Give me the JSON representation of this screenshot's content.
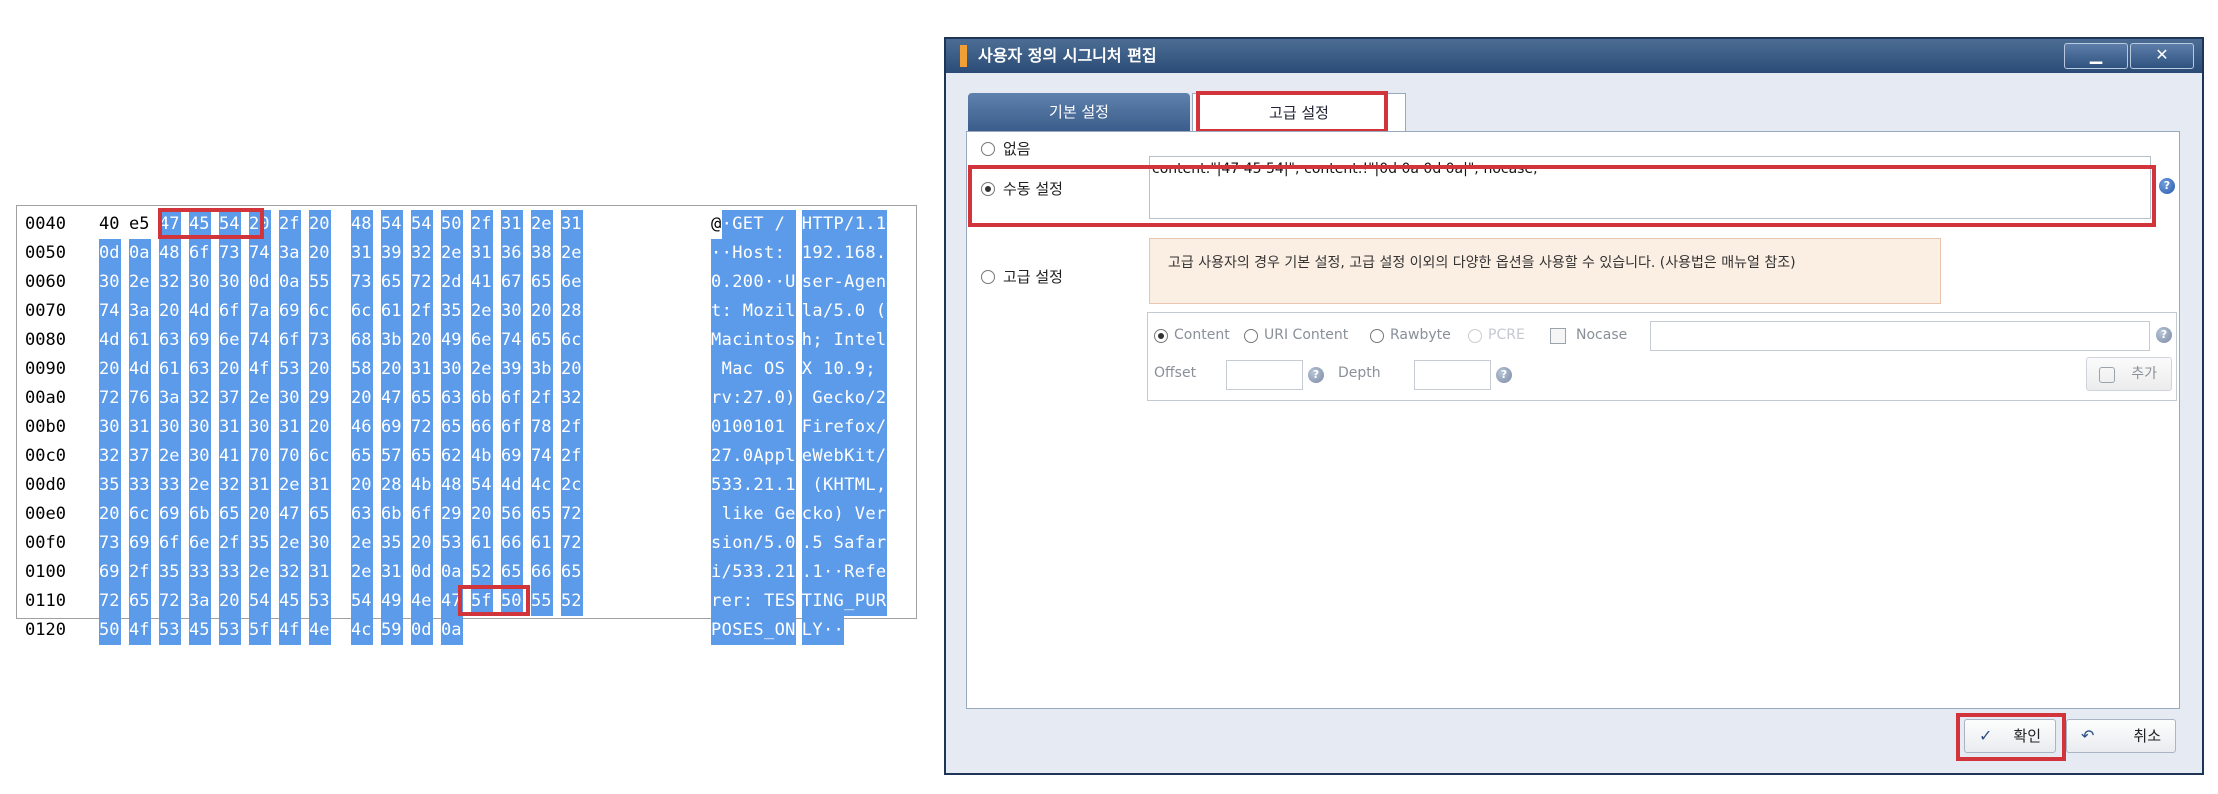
{
  "hexdump": {
    "rows": [
      {
        "offset": "0040",
        "hex": [
          "40",
          "e5",
          "47",
          "45",
          "54",
          "20",
          "2f",
          "20",
          "48",
          "54",
          "54",
          "50",
          "2f",
          "31",
          "2e",
          "31"
        ],
        "ascii": "@·GET / HTTP/1.1"
      },
      {
        "offset": "0050",
        "hex": [
          "0d",
          "0a",
          "48",
          "6f",
          "73",
          "74",
          "3a",
          "20",
          "31",
          "39",
          "32",
          "2e",
          "31",
          "36",
          "38",
          "2e"
        ],
        "ascii": "··Host: 192.168."
      },
      {
        "offset": "0060",
        "hex": [
          "30",
          "2e",
          "32",
          "30",
          "30",
          "0d",
          "0a",
          "55",
          "73",
          "65",
          "72",
          "2d",
          "41",
          "67",
          "65",
          "6e"
        ],
        "ascii": "0.200··User-Agen"
      },
      {
        "offset": "0070",
        "hex": [
          "74",
          "3a",
          "20",
          "4d",
          "6f",
          "7a",
          "69",
          "6c",
          "6c",
          "61",
          "2f",
          "35",
          "2e",
          "30",
          "20",
          "28"
        ],
        "ascii": "t: Mozilla/5.0 ("
      },
      {
        "offset": "0080",
        "hex": [
          "4d",
          "61",
          "63",
          "69",
          "6e",
          "74",
          "6f",
          "73",
          "68",
          "3b",
          "20",
          "49",
          "6e",
          "74",
          "65",
          "6c"
        ],
        "ascii": "Macintosh; Intel"
      },
      {
        "offset": "0090",
        "hex": [
          "20",
          "4d",
          "61",
          "63",
          "20",
          "4f",
          "53",
          "20",
          "58",
          "20",
          "31",
          "30",
          "2e",
          "39",
          "3b",
          "20"
        ],
        "ascii": " Mac OS X 10.9; "
      },
      {
        "offset": "00a0",
        "hex": [
          "72",
          "76",
          "3a",
          "32",
          "37",
          "2e",
          "30",
          "29",
          "20",
          "47",
          "65",
          "63",
          "6b",
          "6f",
          "2f",
          "32"
        ],
        "ascii": "rv:27.0) Gecko/2"
      },
      {
        "offset": "00b0",
        "hex": [
          "30",
          "31",
          "30",
          "30",
          "31",
          "30",
          "31",
          "20",
          "46",
          "69",
          "72",
          "65",
          "66",
          "6f",
          "78",
          "2f"
        ],
        "ascii": "0100101 Firefox/"
      },
      {
        "offset": "00c0",
        "hex": [
          "32",
          "37",
          "2e",
          "30",
          "41",
          "70",
          "70",
          "6c",
          "65",
          "57",
          "65",
          "62",
          "4b",
          "69",
          "74",
          "2f"
        ],
        "ascii": "27.0AppleWebKit/"
      },
      {
        "offset": "00d0",
        "hex": [
          "35",
          "33",
          "33",
          "2e",
          "32",
          "31",
          "2e",
          "31",
          "20",
          "28",
          "4b",
          "48",
          "54",
          "4d",
          "4c",
          "2c"
        ],
        "ascii": "533.21.1 (KHTML,"
      },
      {
        "offset": "00e0",
        "hex": [
          "20",
          "6c",
          "69",
          "6b",
          "65",
          "20",
          "47",
          "65",
          "63",
          "6b",
          "6f",
          "29",
          "20",
          "56",
          "65",
          "72"
        ],
        "ascii": " like Gecko) Ver"
      },
      {
        "offset": "00f0",
        "hex": [
          "73",
          "69",
          "6f",
          "6e",
          "2f",
          "35",
          "2e",
          "30",
          "2e",
          "35",
          "20",
          "53",
          "61",
          "66",
          "61",
          "72"
        ],
        "ascii": "sion/5.0.5 Safar"
      },
      {
        "offset": "0100",
        "hex": [
          "69",
          "2f",
          "35",
          "33",
          "33",
          "2e",
          "32",
          "31",
          "2e",
          "31",
          "0d",
          "0a",
          "52",
          "65",
          "66",
          "65"
        ],
        "ascii": "i/533.21.1··Refe"
      },
      {
        "offset": "0110",
        "hex": [
          "72",
          "65",
          "72",
          "3a",
          "20",
          "54",
          "45",
          "53",
          "54",
          "49",
          "4e",
          "47",
          "5f",
          "50",
          "55",
          "52"
        ],
        "ascii": "rer: TESTING_PUR"
      },
      {
        "offset": "0120",
        "hex": [
          "50",
          "4f",
          "53",
          "45",
          "53",
          "5f",
          "4f",
          "4e",
          "4c",
          "59",
          "0d",
          "0a"
        ],
        "ascii": "POSES_ONLY··"
      }
    ]
  },
  "dialog": {
    "title": "사용자 정의 시그니처 편집",
    "min_label": "▁",
    "close_label": "✕",
    "tabs": {
      "basic": "기본 설정",
      "advanced": "고급 설정"
    },
    "options": {
      "none": "없음",
      "manual": "수동 설정",
      "advanced": "고급 설정"
    },
    "manual_value": "content:\"|47 45 54|\"; content:!\"|0d 0a 0d 0a|\"; nocase;",
    "help_glyph": "?",
    "notice": "고급 사용자의 경우 기본 설정, 고급 설정 이외의 다양한 옵션을 사용할 수 있습니다. (사용법은 매뉴얼 참조)",
    "adv": {
      "content": "Content",
      "uri_content": "URI Content",
      "rawbyte": "Rawbyte",
      "pcre": "PCRE",
      "nocase": "Nocase",
      "offset": "Offset",
      "depth": "Depth",
      "add": "추가"
    },
    "buttons": {
      "ok": "확인",
      "cancel": "취소",
      "ok_icon": "✓",
      "cancel_icon": "↶"
    },
    "colors": {
      "selection": "#5b9bea",
      "highlight_box": "#d2343c",
      "titlebar": "#2b4c76"
    }
  }
}
